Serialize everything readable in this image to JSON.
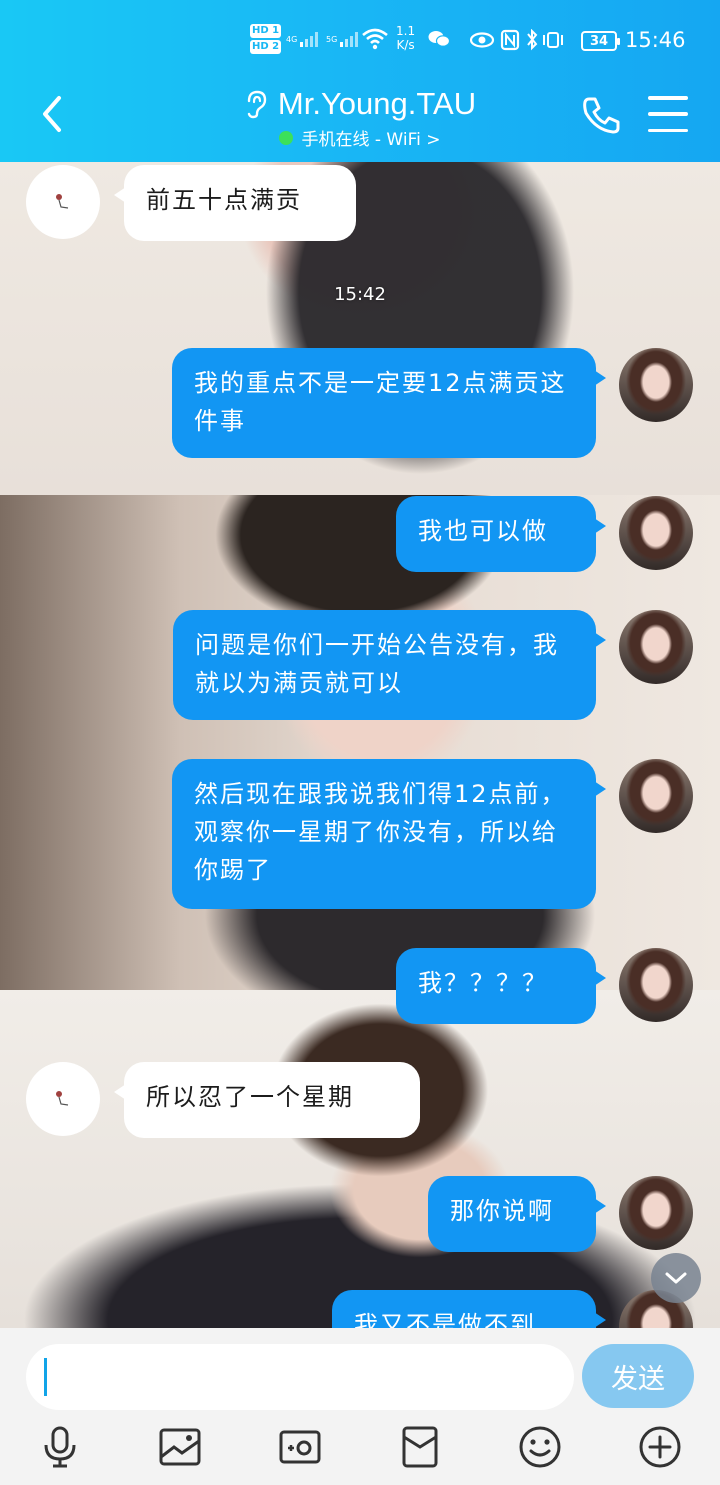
{
  "status_bar": {
    "sim1": "HD 1",
    "sim2": "HD 2",
    "net1": "4G",
    "net2": "5G",
    "speed_value": "1.1",
    "speed_unit": "K/s",
    "battery": "34",
    "time": "15:46"
  },
  "header": {
    "title": "Mr.Young.TAU",
    "subtitle": "手机在线 - WiFi >"
  },
  "messages": [
    {
      "side": "left",
      "text": "前五十点满贡"
    },
    {
      "side": "timestamp",
      "text": "15:42"
    },
    {
      "side": "right",
      "text": "我的重点不是一定要12点满贡这件事"
    },
    {
      "side": "right",
      "text": "我也可以做"
    },
    {
      "side": "right",
      "text": "问题是你们一开始公告没有，我就以为满贡就可以"
    },
    {
      "side": "right",
      "text": "然后现在跟我说我们得12点前，观察你一星期了你没有，所以给你踢了"
    },
    {
      "side": "right",
      "text": "我？？？？"
    },
    {
      "side": "left",
      "text": "所以忍了一个星期"
    },
    {
      "side": "right",
      "text": "那你说啊"
    },
    {
      "side": "right",
      "text": "我又不是做不到"
    }
  ],
  "input": {
    "value": "",
    "send_label": "发送"
  },
  "toolbar": [
    "mic-icon",
    "image-icon",
    "camera-icon",
    "red-packet-icon",
    "emoji-icon",
    "plus-icon"
  ],
  "colors": {
    "header": "#19b6f5",
    "bubble_mine": "#1296f3",
    "bubble_theirs": "#ffffff",
    "send_button": "#86c8f0"
  }
}
